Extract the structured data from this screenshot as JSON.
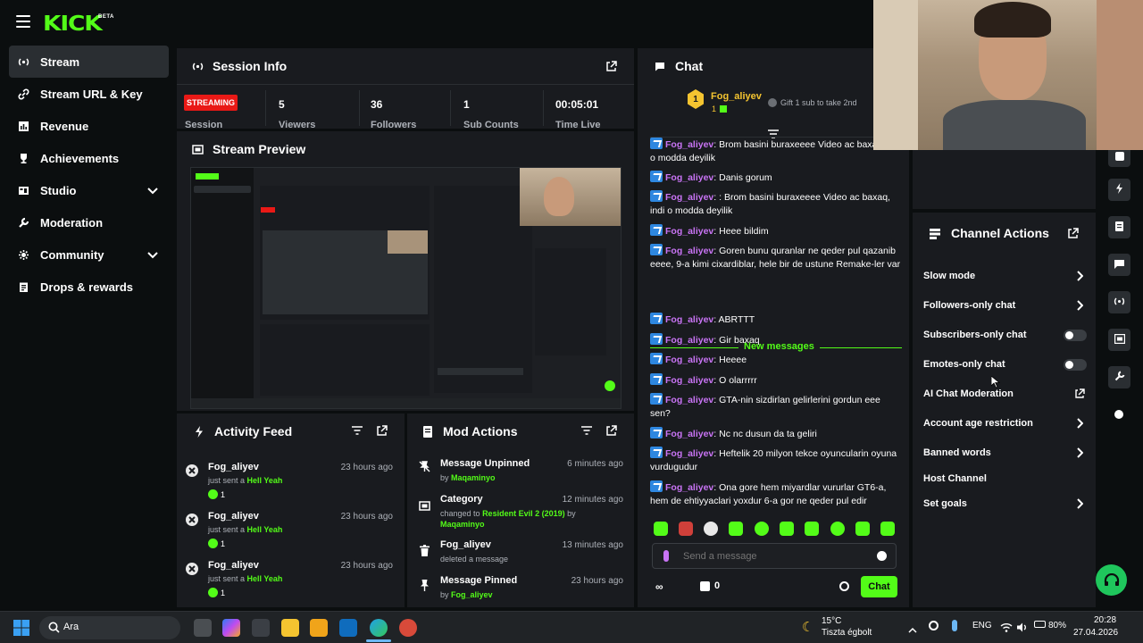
{
  "brand": {
    "logo": "KICK",
    "badge": "BETA"
  },
  "sidebar": {
    "items": [
      {
        "label": "Stream"
      },
      {
        "label": "Stream URL & Key"
      },
      {
        "label": "Revenue"
      },
      {
        "label": "Achievements"
      },
      {
        "label": "Studio"
      },
      {
        "label": "Moderation"
      },
      {
        "label": "Community"
      },
      {
        "label": "Drops & rewards"
      }
    ]
  },
  "session": {
    "title": "Session Info",
    "status": "STREAMING",
    "status_label": "Session",
    "stats": [
      {
        "value": "5",
        "label": "Viewers"
      },
      {
        "value": "36",
        "label": "Followers"
      },
      {
        "value": "1",
        "label": "Sub Counts"
      },
      {
        "value": "00:05:01",
        "label": "Time Live"
      }
    ]
  },
  "preview": {
    "title": "Stream Preview"
  },
  "activity": {
    "title": "Activity Feed",
    "items": [
      {
        "name": "Fog_aliyev",
        "time": "23 hours ago",
        "action": "just sent a",
        "item": "Hell Yeah",
        "count": "1"
      },
      {
        "name": "Fog_aliyev",
        "time": "23 hours ago",
        "action": "just sent a",
        "item": "Hell Yeah",
        "count": "1"
      },
      {
        "name": "Fog_aliyev",
        "time": "23 hours ago",
        "action": "just sent a",
        "item": "Hell Yeah",
        "count": "1"
      }
    ]
  },
  "mod": {
    "title": "Mod Actions",
    "items": [
      {
        "title": "Message Unpinned",
        "time": "6 minutes ago",
        "pre": "by",
        "hl": "Maqaminyo",
        "post": ""
      },
      {
        "title": "Category",
        "time": "12 minutes ago",
        "pre": "changed to",
        "hl": "Resident Evil 2 (2019)",
        "post": "by",
        "hl2": "Maqaminyo"
      },
      {
        "title": "Fog_aliyev",
        "time": "13 minutes ago",
        "pre": "deleted a message",
        "hl": "",
        "post": ""
      },
      {
        "title": "Message Pinned",
        "time": "23 hours ago",
        "pre": "by",
        "hl": "Fog_aliyev",
        "post": ""
      }
    ]
  },
  "chat": {
    "title": "Chat",
    "top_gifter": {
      "name": "Fog_aliyev",
      "rank": "1",
      "count": "1"
    },
    "gift_text": "Gift 1 sub to take 2nd",
    "new_messages_label": "New messages",
    "messages": [
      {
        "user": "Fog_aliyev",
        "text": "Brom basini buraxeeee Video ac baxaq indi o modda deyilik"
      },
      {
        "user": "Fog_aliyev",
        "text": "Danis gorum"
      },
      {
        "user": "Fog_aliyev",
        "text": ": Brom basini buraxeeee Video ac baxaq, indi o modda deyilik"
      },
      {
        "user": "Fog_aliyev",
        "text": "Heee bildim"
      },
      {
        "user": "Fog_aliyev",
        "text": "Goren bunu quranlar ne qeder pul qazanib eeee, 9-a kimi cixardiblar, hele bir de ustune Remake-ler var"
      },
      {
        "user": "Fog_aliyev",
        "text": "ABRTTT"
      },
      {
        "user": "Fog_aliyev",
        "text": "Gir baxaq"
      },
      {
        "user": "Fog_aliyev",
        "text": "Heeee"
      },
      {
        "user": "Fog_aliyev",
        "text": "O olarrrrr"
      },
      {
        "user": "Fog_aliyev",
        "text": "GTA-nin sizdirlan gelirlerini gordun eee sen?"
      },
      {
        "user": "Fog_aliyev",
        "text": "Nc nc dusun da ta geliri"
      },
      {
        "user": "Fog_aliyev",
        "text": "Heftelik 20 milyon tekce oyuncularin oyuna vurdugudur"
      },
      {
        "user": "Fog_aliyev",
        "text": "Ona gore hem miyardlar vururlar GT6-a, hem de ehtiyyaclari yoxdur 6-a gor ne qeder pul edir"
      }
    ],
    "send_placeholder": "Send a message",
    "points": "0",
    "chat_button": "Chat"
  },
  "channel_actions": {
    "title": "Channel Actions",
    "items": [
      {
        "label": "Slow mode",
        "control": "arrow"
      },
      {
        "label": "Followers-only chat",
        "control": "arrow"
      },
      {
        "label": "Subscribers-only chat",
        "control": "toggle"
      },
      {
        "label": "Emotes-only chat",
        "control": "toggle"
      },
      {
        "label": "AI Chat Moderation",
        "control": "external"
      },
      {
        "label": "Account age restriction",
        "control": "arrow"
      },
      {
        "label": "Banned words",
        "control": "arrow"
      },
      {
        "label": "Host Channel",
        "control": "none"
      },
      {
        "label": "Set goals",
        "control": "arrow"
      }
    ]
  },
  "taskbar": {
    "search": "Ara",
    "weather_temp": "15°C",
    "weather_desc": "Tiszta égbolt",
    "lang": "ENG",
    "battery": "80%",
    "time": "20:28",
    "date": "27.04.2026"
  },
  "colors": {
    "accent": "#53fc18",
    "live": "#e91916",
    "username": "#c974f5",
    "panel": "#191b1f",
    "bg": "#0b0e0f"
  }
}
